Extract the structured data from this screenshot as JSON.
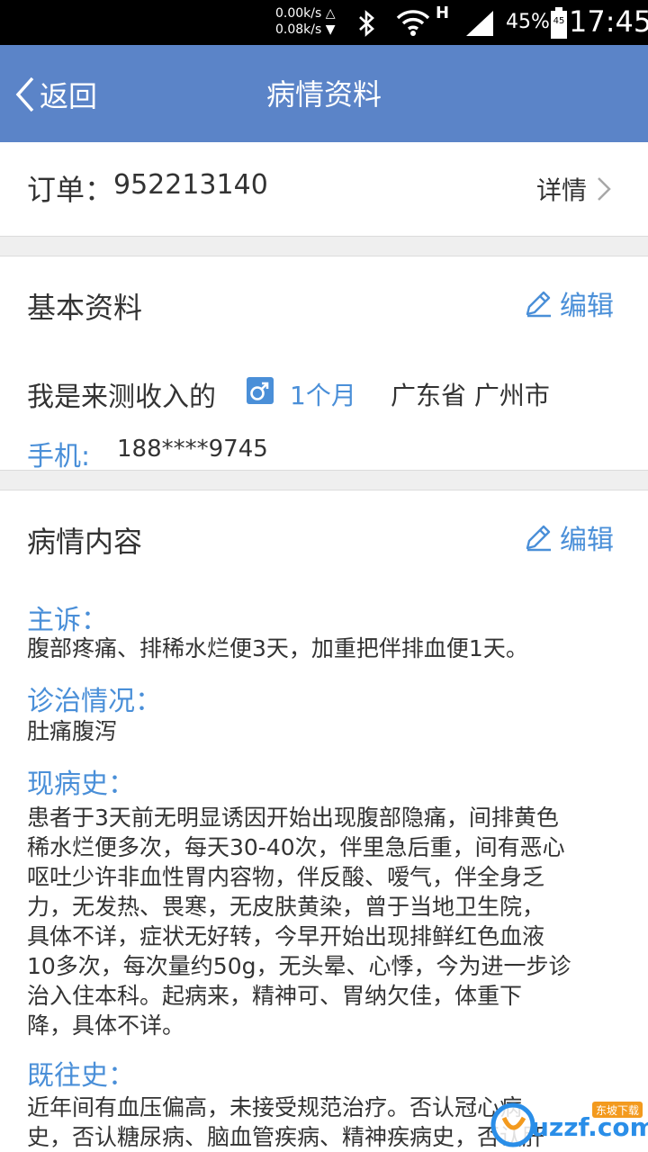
{
  "status_bar": {
    "net_up": "0.00k/s △",
    "net_down": "0.08k/s ▼",
    "network_type": "H",
    "battery": "45%",
    "battery_badge": "45",
    "time": "17:45"
  },
  "appbar": {
    "back_label": "返回",
    "title": "病情资料"
  },
  "order": {
    "label": "订单：",
    "number": "952213140",
    "detail_label": "详情"
  },
  "basic": {
    "title": "基本资料",
    "edit_label": "编辑",
    "name": "我是来测收入的",
    "gender": "male",
    "age": "1个月",
    "location": "广东省 广州市",
    "phone_label": "手机:",
    "phone": "188****9745"
  },
  "condition": {
    "title": "病情内容",
    "edit_label": "编辑",
    "chief_complaint_label": "主诉：",
    "chief_complaint": "腹部疼痛、排稀水烂便3天，加重把伴排血便1天。",
    "diagnosis_label": "诊治情况：",
    "diagnosis": "肚痛腹泻",
    "present_illness_label": "现病史：",
    "present_illness_lines": [
      "患者于3天前无明显诱因开始出现腹部隐痛，间排黄色",
      "稀水烂便多次，每天30-40次，伴里急后重，间有恶心",
      "呕吐少许非血性胃内容物，伴反酸、嗳气，伴全身乏",
      "力，无发热、畏寒，无皮肤黄染，曾于当地卫生院，",
      "具体不详，症状无好转，今早开始出现排鲜红色血液",
      "10多次，每次量约50g，无头晕、心悸，今为进一步诊",
      "治入住本科。起病来，精神可、胃纳欠佳，体重下",
      "降，具体不详。"
    ],
    "past_history_label": "既往史：",
    "past_history_lines": [
      "近年间有血压偏高，未接受规范治疗。否认冠心病",
      "史，否认糖尿病、脑血管疾病、精神疾病史，否认肝"
    ]
  },
  "watermark": {
    "text": "uzzf.com",
    "sub": "东坡下载"
  },
  "colors": {
    "appbar": "#5b84c8",
    "accent": "#4a8fd8",
    "divider": "#efefef"
  }
}
